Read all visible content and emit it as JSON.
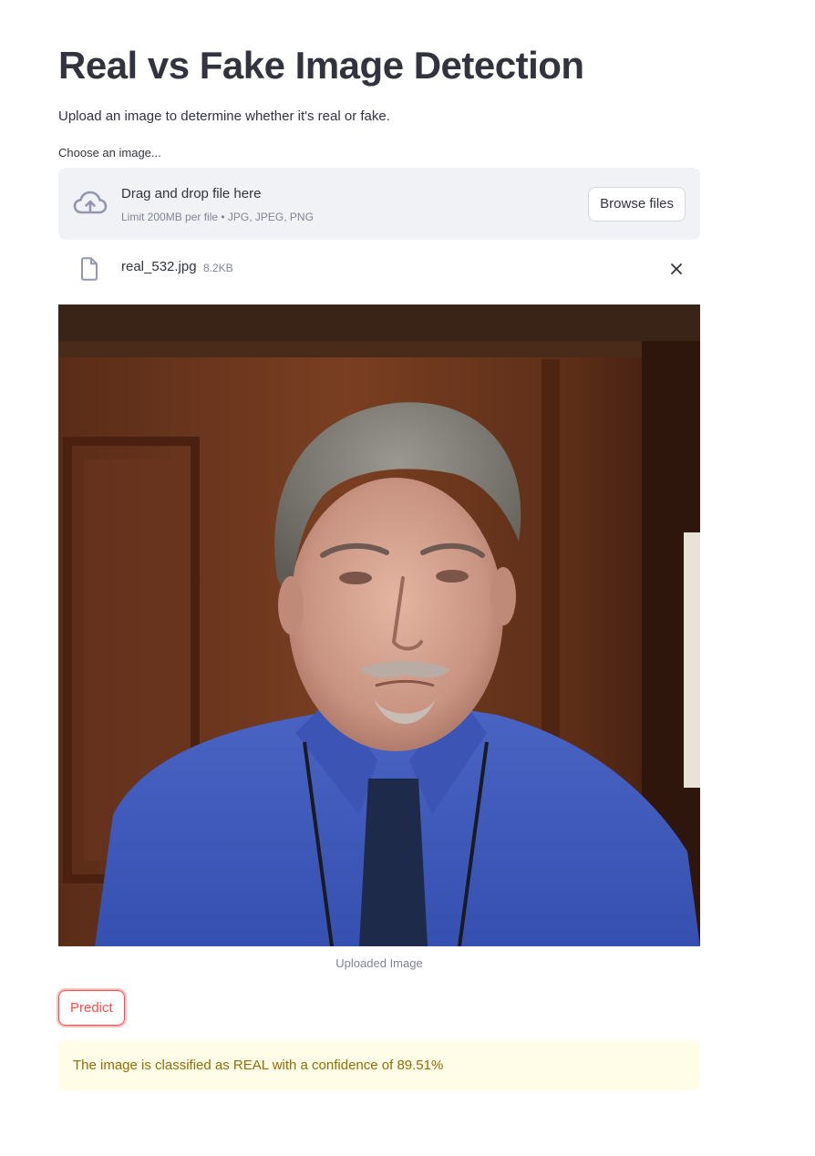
{
  "page": {
    "title": "Real vs Fake Image Detection",
    "subtitle": "Upload an image to determine whether it's real or fake."
  },
  "uploader": {
    "label": "Choose an image...",
    "drop_text": "Drag and drop file here",
    "limits": "Limit 200MB per file • JPG, JPEG, PNG",
    "browse_label": "Browse files",
    "cloud_icon": "cloud-upload-icon"
  },
  "file": {
    "name": "real_532.jpg",
    "size": "8.2KB",
    "file_icon": "file-icon",
    "remove_icon": "close-icon"
  },
  "image": {
    "caption": "Uploaded Image"
  },
  "actions": {
    "predict_label": "Predict"
  },
  "result": {
    "message": "The image is classified as REAL with a confidence of 89.51%"
  },
  "colors": {
    "primary": "#ff4b4b",
    "text": "#31333f",
    "muted": "#808495",
    "dropzone_bg": "#f0f2f6",
    "warning_bg": "#fffce7",
    "warning_text": "#926c05"
  }
}
